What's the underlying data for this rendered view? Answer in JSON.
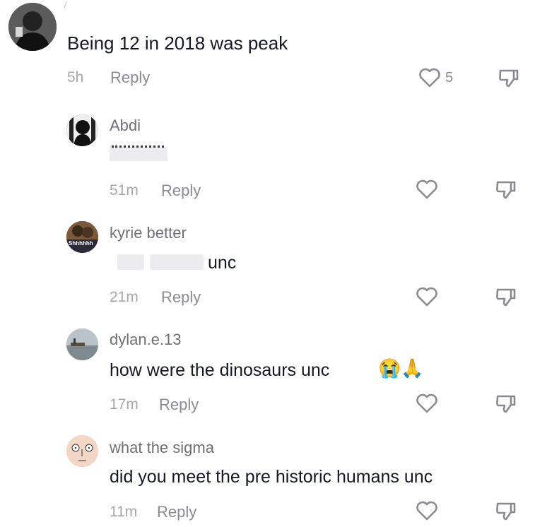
{
  "main_comment": {
    "avatar": "user-avatar",
    "text": "Being 12 in 2018 was peak",
    "time": "5h",
    "reply_label": "Reply",
    "like_count": "5"
  },
  "replies": [
    {
      "username": "Abdi",
      "text": "",
      "time": "51m",
      "reply_label": "Reply"
    },
    {
      "username": "kyrie better",
      "avatar_text": "Shhhhhh",
      "text": "unc",
      "time": "21m",
      "reply_label": "Reply"
    },
    {
      "username": "dylan.e.13",
      "text": "how were the dinosaurs unc",
      "emoji": "😭🙏",
      "time": "17m",
      "reply_label": "Reply"
    },
    {
      "username": "what the sigma",
      "text": "did you meet the pre historic humans unc",
      "time": "11m",
      "reply_label": "Reply"
    }
  ],
  "icons": {
    "like": "heart-outline-icon",
    "dislike": "thumbs-down-icon"
  },
  "colors": {
    "text": "#161823",
    "muted": "#8a8b91",
    "time": "#a6a7ab"
  }
}
